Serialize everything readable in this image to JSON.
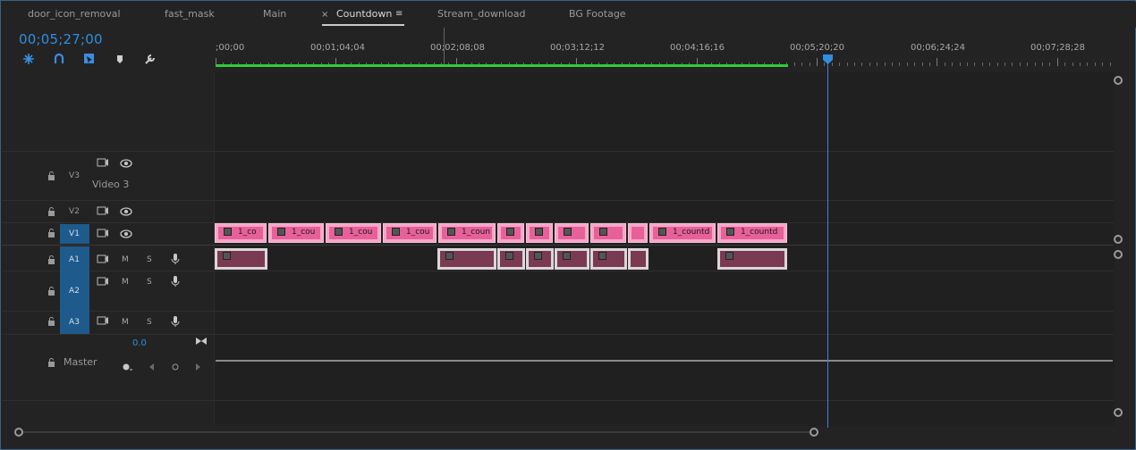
{
  "tabs": [
    {
      "label": "door_icon_removal",
      "active": false
    },
    {
      "label": "fast_mask",
      "active": false
    },
    {
      "label": "Main",
      "active": false
    },
    {
      "label": "Countdown",
      "active": true
    },
    {
      "label": "Stream_download",
      "active": false
    },
    {
      "label": "BG Footage",
      "active": false
    }
  ],
  "tab_close": "×",
  "tab_menu": "≡",
  "timecode": "00;05;27;00",
  "ruler_labels": [
    ";00;00",
    "00;01;04;04",
    "00;02;08;08",
    "00;03;12;12",
    "00;04;16;16",
    "00;05;20;20",
    "00;06;24;24",
    "00;07;28;28"
  ],
  "toolbar_icons": [
    "snap-icon",
    "linked-selection-icon",
    "add-edit-icon",
    "marker-icon",
    "settings-wrench-icon"
  ],
  "tracks": {
    "v3": {
      "label": "V3",
      "name": "Video 3"
    },
    "v2": {
      "label": "V2"
    },
    "v1": {
      "label": "V1"
    },
    "a1": {
      "label": "A1",
      "m": "M",
      "s": "S"
    },
    "a2": {
      "label": "A2",
      "m": "M",
      "s": "S"
    },
    "a3": {
      "label": "A3",
      "m": "M",
      "s": "S"
    },
    "master": {
      "name": "Master",
      "volume": "0.0"
    }
  },
  "video_clips": [
    "1_co",
    "1_cou",
    "1_cou",
    "1_cou",
    "1_coun",
    "",
    "",
    "",
    "",
    "",
    "1_countd",
    "1_countd"
  ],
  "colors": {
    "accent": "#2f8ee0",
    "video_clip": "#e8609a",
    "audio_clip": "#7a3a52",
    "work_area": "#2ecc3a",
    "track_selected": "#1e5a8c"
  }
}
